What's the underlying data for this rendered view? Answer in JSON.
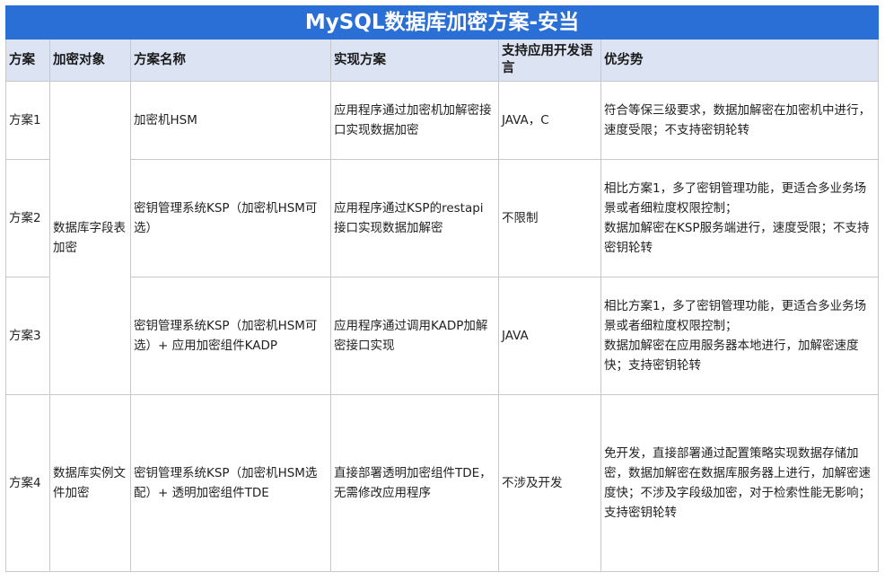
{
  "title": "MySQL数据库加密方案-安当",
  "headers": {
    "plan": "方案",
    "target": "加密对象",
    "name": "方案名称",
    "implementation": "实现方案",
    "languages": "支持应用开发语言",
    "pros_cons": "优劣势"
  },
  "targets": {
    "field": "数据库字段表加密",
    "file": "数据库实例文件加密"
  },
  "rows": [
    {
      "plan": "方案1",
      "name": "加密机HSM",
      "implementation": "应用程序通过加密机加解密接口实现数据加密",
      "languages": "JAVA，C",
      "pros_cons": "符合等保三级要求，数据加解密在加密机中进行，速度受限；不支持密钥轮转"
    },
    {
      "plan": "方案2",
      "name": "密钥管理系统KSP（加密机HSM可选）",
      "implementation": "应用程序通过KSP的restapi接口实现数据加解密",
      "languages": "不限制",
      "pros_cons_1": "相比方案1，多了密钥管理功能，更适合多业务场景或者细粒度权限控制；",
      "pros_cons_2": "数据加解密在KSP服务端进行，速度受限；不支持密钥轮转"
    },
    {
      "plan": "方案3",
      "name": "密钥管理系统KSP（加密机HSM可选）+ 应用加密组件KADP",
      "implementation": "应用程序通过调用KADP加解密接口实现",
      "languages": "JAVA",
      "pros_cons_1": "相比方案1，多了密钥管理功能，更适合多业务场景或者细粒度权限控制；",
      "pros_cons_2": "数据加解密在应用服务器本地进行，加解密速度快；支持密钥轮转"
    },
    {
      "plan": "方案4",
      "name": "密钥管理系统KSP（加密机HSM选配）+ 透明加密组件TDE",
      "implementation": "直接部署透明加密组件TDE，无需修改应用程序",
      "languages": "不涉及开发",
      "pros_cons": "免开发，直接部署通过配置策略实现数据存储加密，数据加解密在数据库服务器上进行，加解密速度快；不涉及字段级加密，对于检索性能无影响；支持密钥轮转"
    }
  ]
}
